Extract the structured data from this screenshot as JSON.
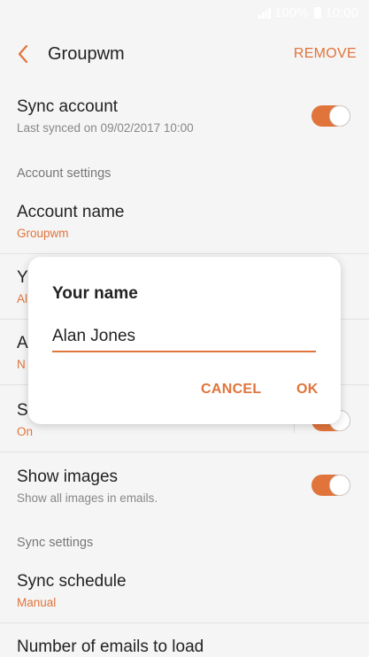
{
  "status": {
    "battery": "100%",
    "time": "10:00"
  },
  "appbar": {
    "title": "Groupwm",
    "remove_label": "REMOVE"
  },
  "sync_account": {
    "title": "Sync account",
    "subtitle": "Last synced on 09/02/2017  10:00",
    "enabled": true
  },
  "sections": {
    "account_settings": "Account settings",
    "sync_settings": "Sync settings"
  },
  "account_name": {
    "title": "Account name",
    "value": "Groupwm"
  },
  "your_name_row": {
    "title": "Y",
    "value": "Al"
  },
  "third_row": {
    "title": "A",
    "value": "N"
  },
  "fourth_row": {
    "title": "S",
    "value": "On"
  },
  "show_images": {
    "title": "Show images",
    "subtitle": "Show all images in emails.",
    "enabled": true
  },
  "sync_schedule": {
    "title": "Sync schedule",
    "value": "Manual"
  },
  "emails_to_load": {
    "title": "Number of emails to load"
  },
  "dialog": {
    "title": "Your name",
    "input_value": "Alan Jones",
    "cancel_label": "CANCEL",
    "ok_label": "OK"
  },
  "colors": {
    "accent": "#e0743b",
    "background": "#f5f5f5"
  }
}
